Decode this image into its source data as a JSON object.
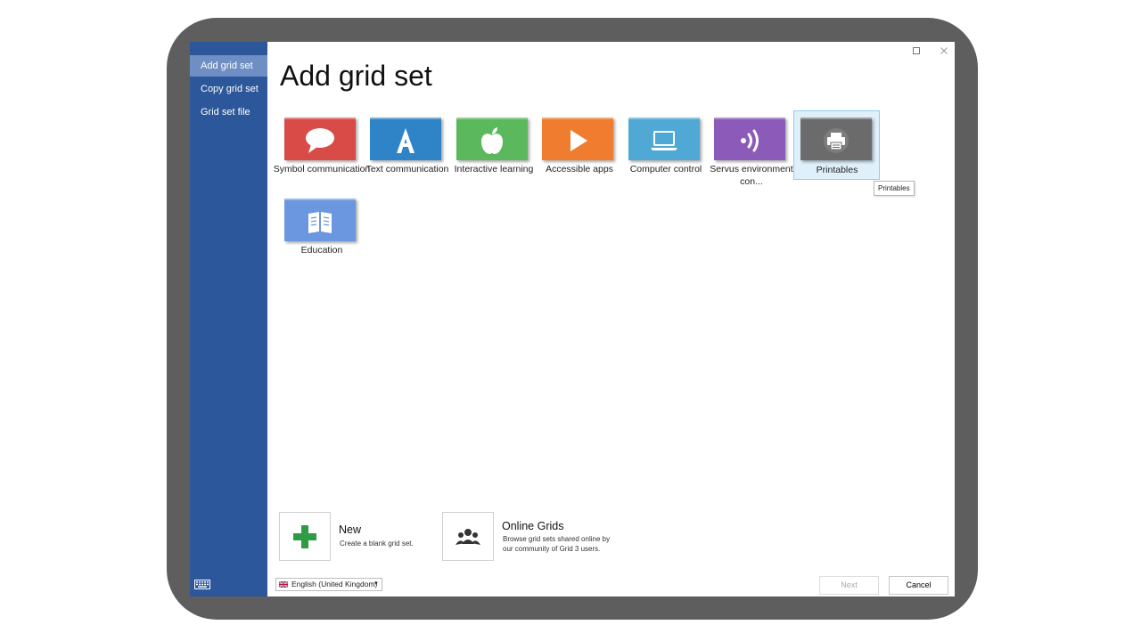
{
  "sidebar": {
    "items": [
      {
        "label": "Add grid set",
        "active": true
      },
      {
        "label": "Copy grid set",
        "active": false
      },
      {
        "label": "Grid set file",
        "active": false
      }
    ],
    "keyboard_icon": "keyboard-icon"
  },
  "window": {
    "controls": [
      "maximize-icon",
      "close-icon"
    ]
  },
  "main": {
    "title": "Add grid set",
    "tiles": [
      {
        "label": "Symbol communication",
        "icon": "speech-bubble-icon",
        "color": "#d94b46"
      },
      {
        "label": "Text communication",
        "icon": "letter-a-icon",
        "color": "#2f84c8"
      },
      {
        "label": "Interactive learning",
        "icon": "apple-icon",
        "color": "#5cb85c"
      },
      {
        "label": "Accessible apps",
        "icon": "play-icon",
        "color": "#f07d2f"
      },
      {
        "label": "Computer control",
        "icon": "laptop-icon",
        "color": "#4fa9d4"
      },
      {
        "label": "Servus environment con...",
        "icon": "signal-waves-icon",
        "color": "#8c5ab8"
      },
      {
        "label": "Printables",
        "icon": "printer-icon",
        "color": "#6b6b6b",
        "selected": true
      },
      {
        "label": "Education",
        "icon": "book-icon",
        "color": "#6b97e0"
      }
    ],
    "tooltip": "Printables",
    "options": {
      "new": {
        "title": "New",
        "description": "Create a blank grid set.",
        "icon": "plus-icon",
        "accent": "#2e9c44"
      },
      "online": {
        "title": "Online Grids",
        "description_line1": "Browse grid sets shared online by",
        "description_line2": "our community of Grid 3 users.",
        "icon": "users-group-icon"
      }
    }
  },
  "footer": {
    "language": "English (United Kingdom)",
    "next_label": "Next",
    "cancel_label": "Cancel"
  },
  "colors": {
    "sidebar": "#2c579a",
    "sidebar_active": "#6f8fc4",
    "device_frame": "#5e5e5e"
  }
}
